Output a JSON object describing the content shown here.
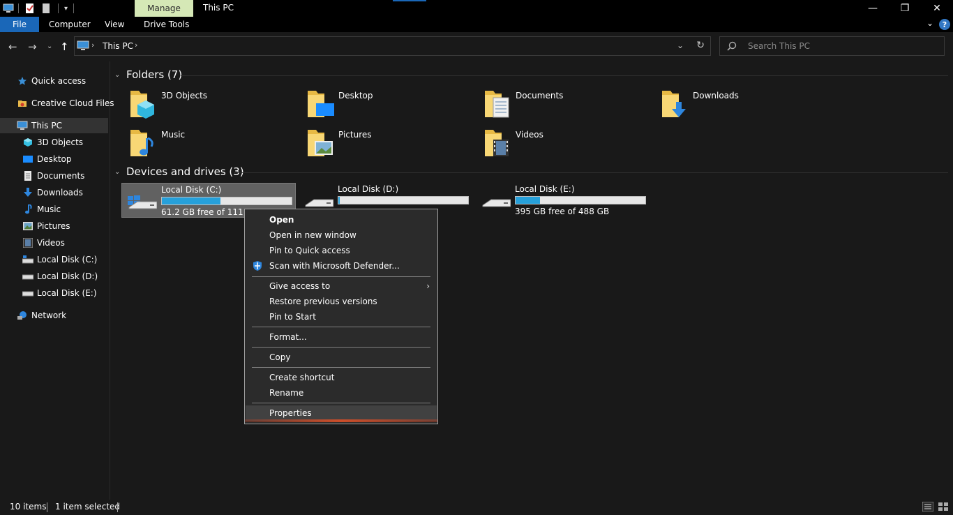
{
  "window": {
    "title": "This PC",
    "context_tab": "Manage"
  },
  "ribbon": {
    "tabs": [
      "File",
      "Computer",
      "View",
      "Drive Tools"
    ]
  },
  "address": {
    "path": "This PC"
  },
  "search": {
    "placeholder": "Search This PC"
  },
  "sidebar": {
    "items": [
      {
        "label": "Quick access",
        "icon": "star-icon"
      },
      {
        "label": "Creative Cloud Files",
        "icon": "creative-cloud-icon"
      },
      {
        "label": "This PC",
        "icon": "computer-icon"
      },
      {
        "label": "3D Objects",
        "icon": "cube-icon"
      },
      {
        "label": "Desktop",
        "icon": "desktop-icon"
      },
      {
        "label": "Documents",
        "icon": "document-icon"
      },
      {
        "label": "Downloads",
        "icon": "download-arrow-icon"
      },
      {
        "label": "Music",
        "icon": "music-note-icon"
      },
      {
        "label": "Pictures",
        "icon": "picture-icon"
      },
      {
        "label": "Videos",
        "icon": "film-icon"
      },
      {
        "label": "Local Disk (C:)",
        "icon": "drive-icon"
      },
      {
        "label": "Local Disk (D:)",
        "icon": "drive-icon"
      },
      {
        "label": "Local Disk (E:)",
        "icon": "drive-icon"
      },
      {
        "label": "Network",
        "icon": "network-icon"
      }
    ]
  },
  "folders": {
    "heading": "Folders (7)",
    "items": [
      {
        "label": "3D Objects"
      },
      {
        "label": "Desktop"
      },
      {
        "label": "Documents"
      },
      {
        "label": "Downloads"
      },
      {
        "label": "Music"
      },
      {
        "label": "Pictures"
      },
      {
        "label": "Videos"
      }
    ]
  },
  "drives": {
    "heading": "Devices and drives (3)",
    "items": [
      {
        "name": "Local Disk (C:)",
        "space": "61.2 GB free of 111 GB",
        "used_fraction": 0.45,
        "selected": true
      },
      {
        "name": "Local Disk (D:)",
        "space": "",
        "used_fraction": 0.01,
        "selected": false
      },
      {
        "name": "Local Disk (E:)",
        "space": "395 GB free of 488 GB",
        "used_fraction": 0.19,
        "selected": false
      }
    ]
  },
  "context_menu": {
    "items": [
      "Open",
      "Open in new window",
      "Pin to Quick access",
      "Scan with Microsoft Defender...",
      "Give access to",
      "Restore previous versions",
      "Pin to Start",
      "Format...",
      "Copy",
      "Create shortcut",
      "Rename",
      "Properties"
    ]
  },
  "status": {
    "count": "10 items",
    "selection": "1 item selected"
  },
  "colors": {
    "accent": "#1a67b8",
    "bar_fill": "#26a0da",
    "manage_tab": "#d5e8b6"
  }
}
